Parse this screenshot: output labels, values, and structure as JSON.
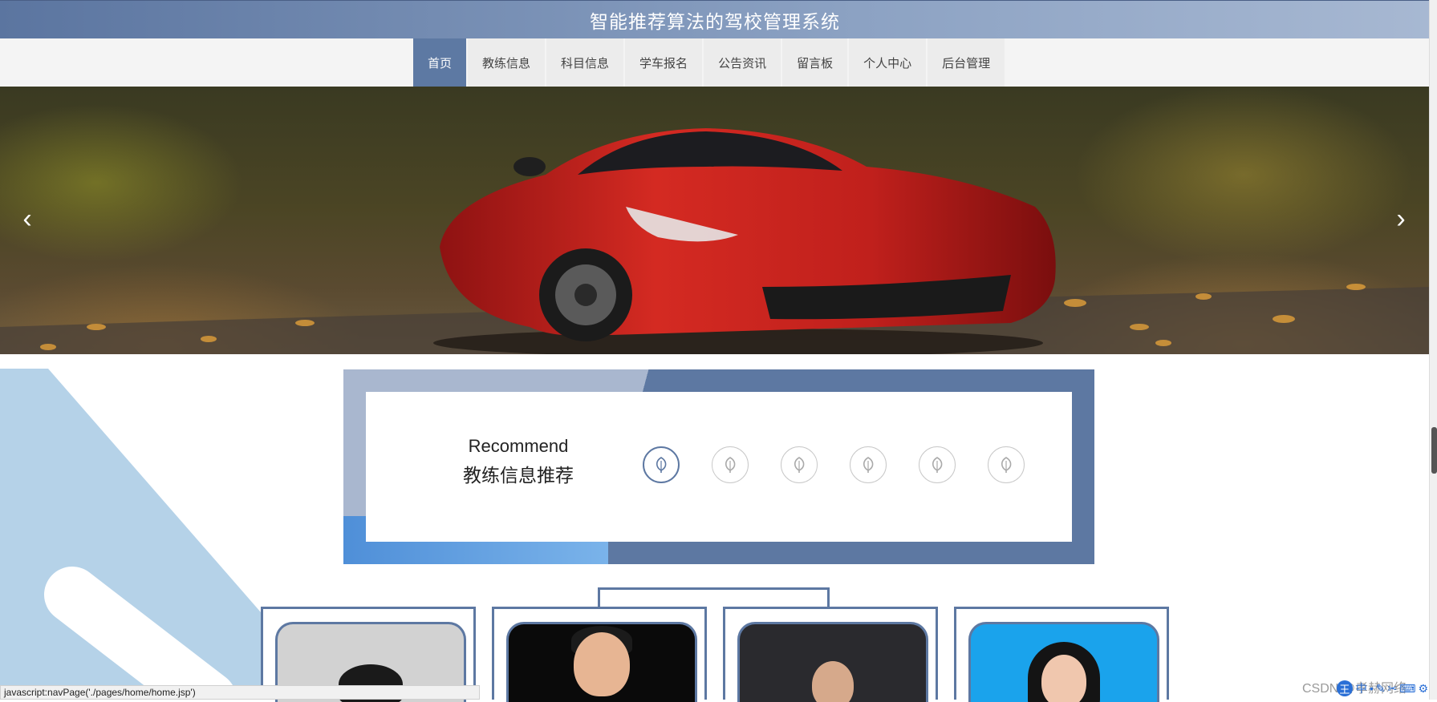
{
  "site": {
    "title": "智能推荐算法的驾校管理系统"
  },
  "nav": {
    "items": [
      {
        "label": "首页",
        "active": true
      },
      {
        "label": "教练信息"
      },
      {
        "label": "科目信息"
      },
      {
        "label": "学车报名"
      },
      {
        "label": "公告资讯"
      },
      {
        "label": "留言板"
      },
      {
        "label": "个人中心"
      },
      {
        "label": "后台管理"
      }
    ]
  },
  "carousel": {
    "prev_icon": "chevron-left-icon",
    "next_icon": "chevron-right-icon",
    "prev_glyph": "‹",
    "next_glyph": "›"
  },
  "recommend": {
    "title_en": "Recommend",
    "title_zh": "教练信息推荐",
    "indicator_icon": "leaf-icon",
    "active_index": 0,
    "indicator_count": 6
  },
  "coaches": [
    {
      "photo": "coach-photo-1"
    },
    {
      "photo": "coach-photo-2"
    },
    {
      "photo": "coach-photo-3"
    },
    {
      "photo": "coach-photo-4"
    }
  ],
  "status_bar": {
    "url": "javascript:navPage('./pages/home/home.jsp')"
  },
  "tray": {
    "ime": "王",
    "lang": "中",
    "watermark": "CSDN @孝赫网络"
  },
  "colors": {
    "primary": "#5d78a2",
    "header": "#8ca2c3",
    "active_tab": "#5d79a3"
  }
}
